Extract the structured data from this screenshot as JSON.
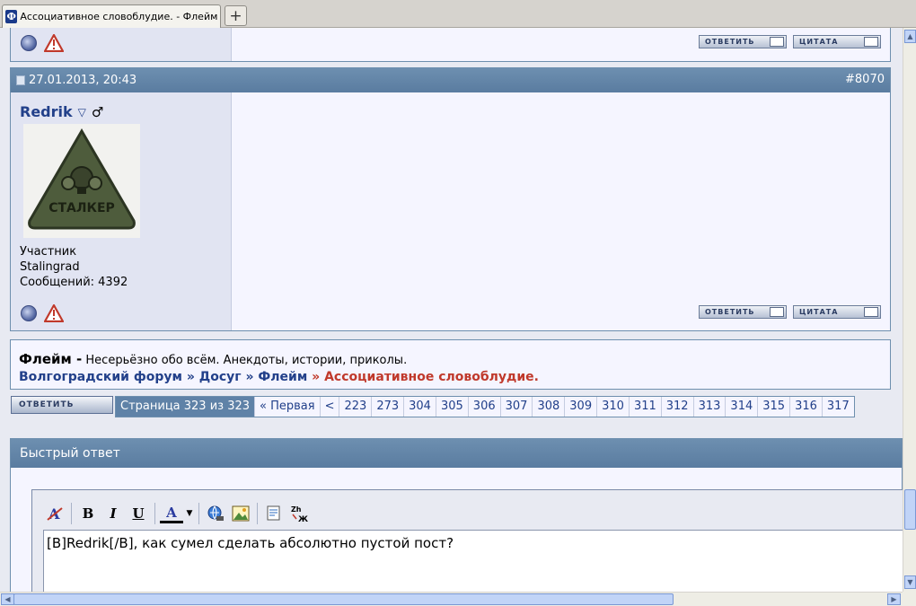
{
  "browser": {
    "tab_favicon": "Ф",
    "tab_title": "Ассоциативное словоблудие. - Флейм - С...",
    "new_tab": "+"
  },
  "post_top": {
    "reply_label": "ОТВЕТИТЬ",
    "quote_label": "ЦИТАТА"
  },
  "post": {
    "date": "27.01.2013, 20:43",
    "number": "#8070",
    "username": "Redrik",
    "status_icon": "▽",
    "gender_icon": "♂",
    "avatar_text": "СТАЛКЕР",
    "rank": "Участник",
    "location": "Stalingrad",
    "posts_label": "Сообщений: 4392",
    "reply_label": "ОТВЕТИТЬ",
    "quote_label": "ЦИТАТА"
  },
  "forum": {
    "name": "Флейм -",
    "description": "Несерьёзно обо всём. Анекдоты, истории, приколы.",
    "crumb1": "Волгоградский форум",
    "crumb2": "Досуг",
    "crumb3": "Флейм",
    "current": "Ассоциативное словоблудие.",
    "separator": "»"
  },
  "pagination": {
    "reply_label": "ОТВЕТИТЬ",
    "current": "Страница 323 из 323",
    "first": "« Первая",
    "prev": "<",
    "pages": [
      "223",
      "273",
      "304",
      "305",
      "306",
      "307",
      "308",
      "309",
      "310",
      "311",
      "312",
      "313",
      "314",
      "315",
      "316",
      "317"
    ]
  },
  "quick_reply": {
    "title": "Быстрый ответ",
    "bold": "B",
    "italic": "I",
    "underline": "U",
    "color": "A",
    "text": "[B]Redrik[/B], как сумел сделать абсолютно пустой пост?"
  }
}
